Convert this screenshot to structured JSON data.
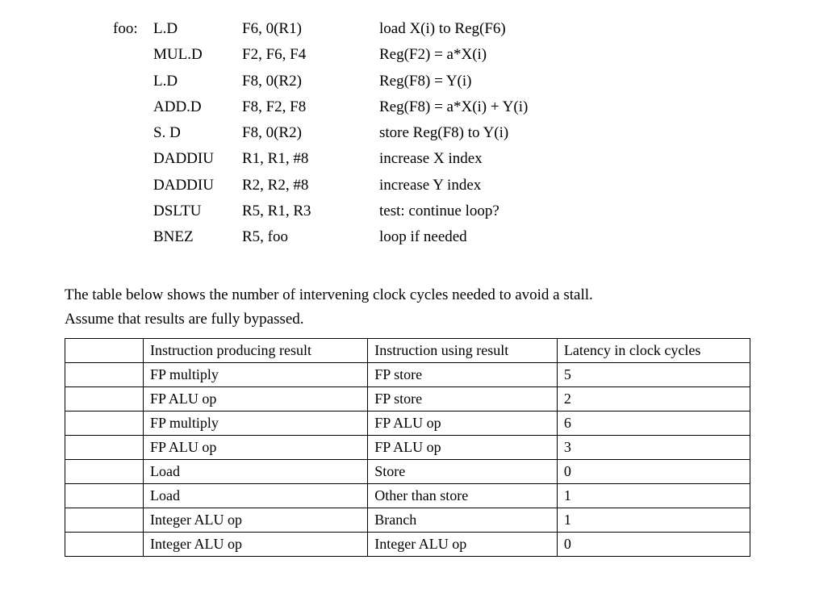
{
  "code": {
    "rows": [
      {
        "label": "foo:",
        "op": "L.D",
        "args": "F6, 0(R1)",
        "comment": "load X(i) to Reg(F6)"
      },
      {
        "label": "",
        "op": "MUL.D",
        "args": "F2, F6, F4",
        "comment": "Reg(F2) = a*X(i)"
      },
      {
        "label": "",
        "op": "L.D",
        "args": "F8, 0(R2)",
        "comment": "Reg(F8) = Y(i)"
      },
      {
        "label": "",
        "op": "ADD.D",
        "args": "F8, F2, F8",
        "comment": "Reg(F8) = a*X(i) + Y(i)"
      },
      {
        "label": "",
        "op": "S. D",
        "args": "F8, 0(R2)",
        "comment": "store Reg(F8) to Y(i)"
      },
      {
        "label": "",
        "op": "DADDIU",
        "args": "R1, R1, #8",
        "comment": "increase X index"
      },
      {
        "label": "",
        "op": "DADDIU",
        "args": "R2, R2, #8",
        "comment": "increase Y index"
      },
      {
        "label": "",
        "op": "DSLTU",
        "args": "R5, R1, R3",
        "comment": "test: continue loop?"
      },
      {
        "label": "",
        "op": "BNEZ",
        "args": "R5, foo",
        "comment": "loop if needed"
      }
    ]
  },
  "paragraph": {
    "line1": "The table below shows the number of intervening clock cycles needed to avoid a stall.",
    "line2": "Assume that results are fully bypassed."
  },
  "table": {
    "headers": {
      "c1": "Instruction producing result",
      "c2": "Instruction using result",
      "c3": "Latency in clock cycles"
    },
    "rows": [
      {
        "c1": "FP multiply",
        "c2": "FP store",
        "c3": "5"
      },
      {
        "c1": "FP ALU op",
        "c2": "FP store",
        "c3": "2"
      },
      {
        "c1": "FP multiply",
        "c2": "FP ALU op",
        "c3": "6"
      },
      {
        "c1": "FP ALU op",
        "c2": "FP ALU op",
        "c3": "3"
      },
      {
        "c1": "Load",
        "c2": "Store",
        "c3": "0"
      },
      {
        "c1": "Load",
        "c2": "Other than store",
        "c3": "1"
      },
      {
        "c1": "Integer ALU op",
        "c2": "Branch",
        "c3": "1"
      },
      {
        "c1": "Integer ALU op",
        "c2": "Integer ALU op",
        "c3": "0"
      }
    ]
  }
}
